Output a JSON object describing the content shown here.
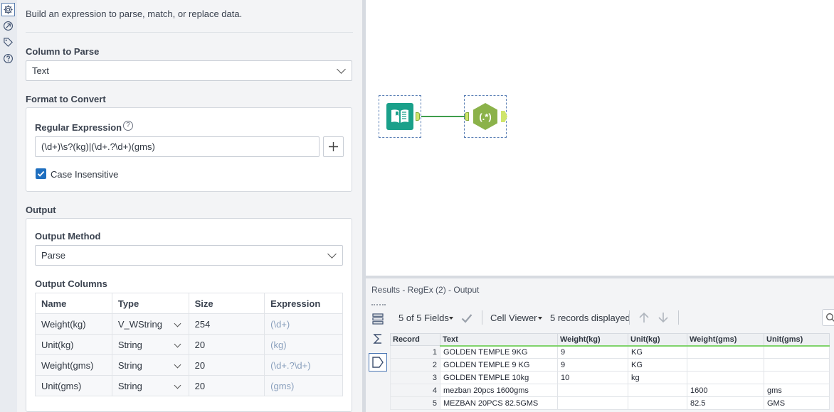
{
  "config": {
    "description": "Build an expression to parse, match, or replace data.",
    "column_to_parse": {
      "label": "Column to Parse",
      "value": "Text"
    },
    "format_to_convert": {
      "label": "Format to Convert",
      "regex_label": "Regular Expression",
      "regex_value": "(\\d+)\\s?(kg)|(\\d+.?\\d+)(gms)",
      "case_insensitive_label": "Case Insensitive",
      "case_insensitive": true
    },
    "output": {
      "label": "Output",
      "method_label": "Output Method",
      "method_value": "Parse",
      "columns_label": "Output Columns",
      "headers": [
        "Name",
        "Type",
        "Size",
        "Expression"
      ],
      "rows": [
        {
          "name": "Weight(kg)",
          "type": "V_WString",
          "size": "254",
          "expression": "(\\d+)"
        },
        {
          "name": "Unit(kg)",
          "type": "String",
          "size": "20",
          "expression": "(kg)"
        },
        {
          "name": "Weight(gms)",
          "type": "String",
          "size": "20",
          "expression": "(\\d+.?\\d+)"
        },
        {
          "name": "Unit(gms)",
          "type": "String",
          "size": "20",
          "expression": "(gms)"
        }
      ]
    }
  },
  "canvas": {
    "connection_color": "#3f9d4c",
    "tools": [
      {
        "icon": "input-data-book-icon",
        "color": "#1aa08a"
      },
      {
        "icon": "regex-tool-icon",
        "color": "#8bb24a",
        "label": "(.*)"
      }
    ]
  },
  "results": {
    "title": "Results - RegEx (2) - Output",
    "fields_selector": "5 of 5 Fields",
    "cell_viewer": "Cell Viewer",
    "records_displayed": "5 records displayed",
    "columns": [
      "Record",
      "Text",
      "Weight(kg)",
      "Unit(kg)",
      "Weight(gms)",
      "Unit(gms)"
    ],
    "rows": [
      [
        "1",
        "GOLDEN TEMPLE 9KG",
        "9",
        "KG",
        "",
        ""
      ],
      [
        "2",
        "GOLDEN TEMPLE 9 KG",
        "9",
        "KG",
        "",
        ""
      ],
      [
        "3",
        "GOLDEN TEMPLE 10kg",
        "10",
        "kg",
        "",
        ""
      ],
      [
        "4",
        "mezban 20pcs 1600gms",
        "",
        "",
        "1600",
        "gms"
      ],
      [
        "5",
        "MEZBAN 20PCS 82.5GMS",
        "",
        "",
        "82.5",
        "GMS"
      ]
    ]
  }
}
